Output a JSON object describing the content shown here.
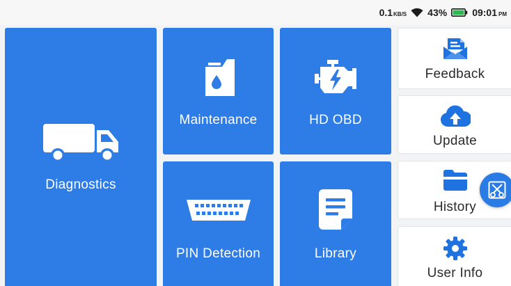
{
  "status": {
    "speed": "0.1",
    "speed_unit": "KB/S",
    "battery": "43%",
    "time": "09:01",
    "ampm": "PM",
    "icons": [
      "wifi-icon",
      "battery-icon"
    ]
  },
  "tiles": {
    "diagnostics": {
      "label": "Diagnostics",
      "icon": "truck-icon"
    },
    "maintenance": {
      "label": "Maintenance",
      "icon": "oil-can-icon"
    },
    "hd_obd": {
      "label": "HD OBD",
      "icon": "engine-icon"
    },
    "pin_detection": {
      "label": "PIN Detection",
      "icon": "obd-connector-icon"
    },
    "library": {
      "label": "Library",
      "icon": "document-icon"
    },
    "feedback": {
      "label": "Feedback",
      "icon": "mail-icon"
    },
    "update": {
      "label": "Update",
      "icon": "cloud-upload-icon"
    },
    "history": {
      "label": "History",
      "icon": "folder-icon"
    },
    "user_info": {
      "label": "User Info",
      "icon": "gear-icon"
    }
  },
  "floating_button": {
    "icon": "screenshot-scissors-icon"
  },
  "colors": {
    "tile_blue": "#2e7de6",
    "accent_blue": "#1f73e0",
    "tile_white": "#ffffff",
    "background": "#f2f3f5",
    "battery_green": "#2db84d"
  }
}
